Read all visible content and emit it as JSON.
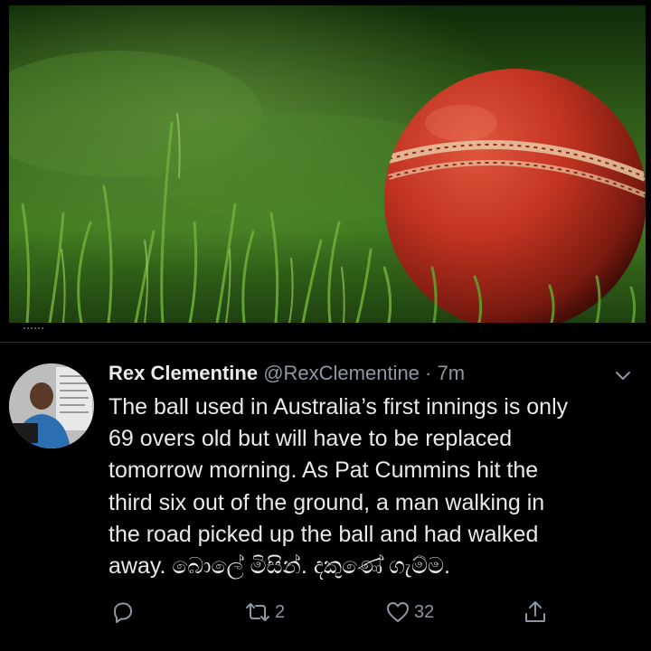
{
  "tweet": {
    "display_name": "Rex Clementine",
    "handle": "@RexClementine",
    "separator": "·",
    "time": "7m",
    "text": "The ball used in Australia’s first innings is only\n69 overs old but will have to be replaced\ntomorrow morning. As Pat Cummins hit the\nthird six out of the ground, a man walking in\nthe road picked up the ball and had walked\naway. බොලේ මිසින්. දකුණේ ගැම්ම.",
    "retweet_count": "2",
    "like_count": "32"
  },
  "icons": {
    "more": "chevron-down-icon",
    "reply": "reply-icon",
    "retweet": "retweet-icon",
    "like": "heart-icon",
    "share": "share-icon"
  },
  "colors": {
    "background": "#000000",
    "primary_text": "#e7e9ea",
    "secondary_text": "#8b98a5",
    "divider": "#2f3336"
  }
}
